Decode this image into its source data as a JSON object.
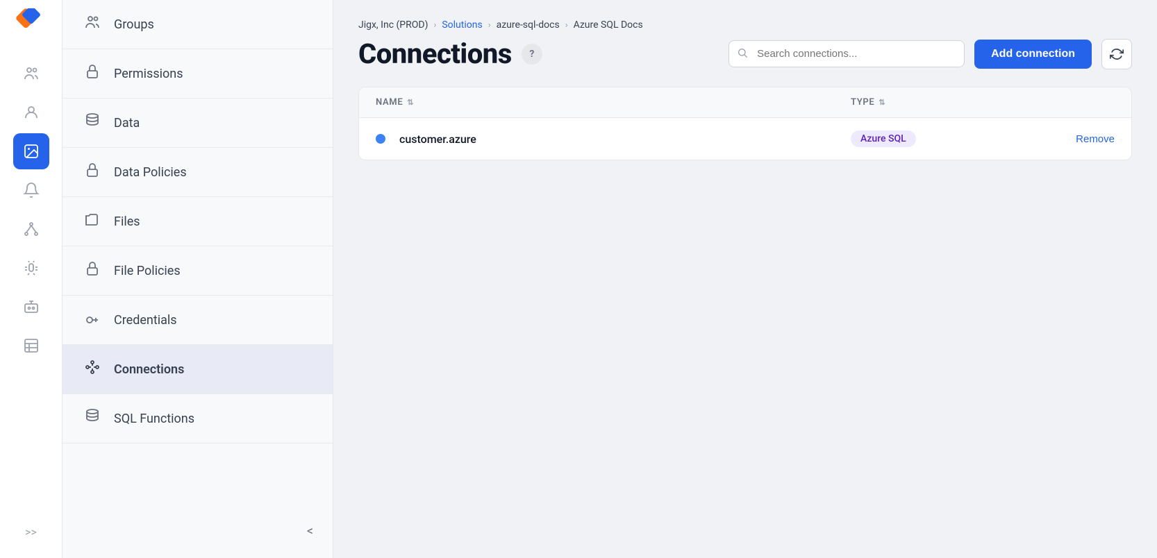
{
  "iconBar": {
    "icons": [
      {
        "name": "users-icon",
        "glyph": "👥",
        "active": false
      },
      {
        "name": "profile-icon",
        "glyph": "👤",
        "active": false
      },
      {
        "name": "image-icon",
        "glyph": "🖼",
        "active": true
      },
      {
        "name": "bell-icon",
        "glyph": "🔔",
        "active": false
      },
      {
        "name": "hierarchy-icon",
        "glyph": "⛓",
        "active": false
      },
      {
        "name": "bug-icon",
        "glyph": "🐛",
        "active": false
      },
      {
        "name": "robot-icon",
        "glyph": "🤖",
        "active": false
      },
      {
        "name": "table-icon",
        "glyph": "▦",
        "active": false
      }
    ],
    "expandLabel": ">>"
  },
  "sidebar": {
    "items": [
      {
        "label": "Groups",
        "icon": "👥",
        "active": false
      },
      {
        "label": "Permissions",
        "icon": "🔒",
        "active": false
      },
      {
        "label": "Data",
        "icon": "🗄",
        "active": false
      },
      {
        "label": "Data Policies",
        "icon": "🔒",
        "active": false
      },
      {
        "label": "Files",
        "icon": "🗂",
        "active": false
      },
      {
        "label": "File Policies",
        "icon": "🔒",
        "active": false
      },
      {
        "label": "Credentials",
        "icon": "🔑",
        "active": false
      },
      {
        "label": "Connections",
        "icon": "⛓",
        "active": true
      },
      {
        "label": "SQL Functions",
        "icon": "🗄",
        "active": false
      }
    ],
    "collapseIcon": "<"
  },
  "breadcrumb": {
    "items": [
      {
        "label": "Jigx, Inc (PROD)",
        "link": false
      },
      {
        "label": "Solutions",
        "link": true
      },
      {
        "label": "azure-sql-docs",
        "link": false
      },
      {
        "label": "Azure SQL Docs",
        "link": false
      }
    ]
  },
  "main": {
    "title": "Connections",
    "helpTooltip": "?",
    "search": {
      "placeholder": "Search connections..."
    },
    "addButtonLabel": "Add connection",
    "refreshIcon": "↺",
    "table": {
      "columns": [
        {
          "label": "NAME",
          "sortable": true
        },
        {
          "label": "TYPE",
          "sortable": true
        }
      ],
      "rows": [
        {
          "name": "customer.azure",
          "type": "Azure SQL",
          "status": "connected",
          "removeLabel": "Remove"
        }
      ]
    }
  }
}
